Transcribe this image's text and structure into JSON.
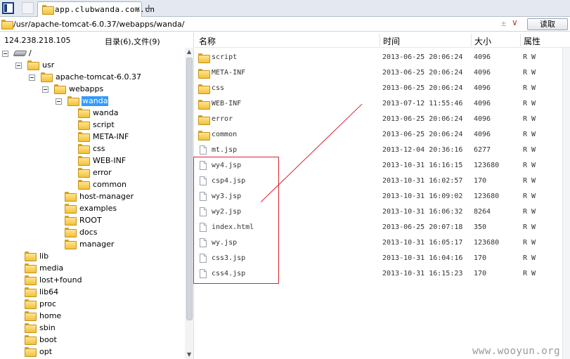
{
  "tab": {
    "title": "app.clubwanda.com.cn",
    "close_icon": "×",
    "add_icon": "+"
  },
  "address": {
    "path": "/usr/apache-tomcat-6.0.37/webapps/wanda/",
    "plus_icon": "±",
    "dropdown_icon": "∨",
    "read_button": "读取"
  },
  "left": {
    "ip": "124.238.218.105",
    "counts": "目录(6),文件(9)",
    "tree": [
      {
        "label": "/",
        "level": 0,
        "icon": "drive",
        "toggle": true
      },
      {
        "label": "usr",
        "level": 1,
        "icon": "folder",
        "toggle": true
      },
      {
        "label": "apache-tomcat-6.0.37",
        "level": 2,
        "icon": "folder",
        "toggle": true
      },
      {
        "label": "webapps",
        "level": 3,
        "icon": "folder",
        "toggle": true
      },
      {
        "label": "wanda",
        "level": 4,
        "icon": "folder",
        "toggle": true,
        "selected": true
      },
      {
        "label": "wanda",
        "level": 5,
        "icon": "folder"
      },
      {
        "label": "script",
        "level": 5,
        "icon": "folder"
      },
      {
        "label": "META-INF",
        "level": 5,
        "icon": "folder"
      },
      {
        "label": "css",
        "level": 5,
        "icon": "folder"
      },
      {
        "label": "WEB-INF",
        "level": 5,
        "icon": "folder"
      },
      {
        "label": "error",
        "level": 5,
        "icon": "folder"
      },
      {
        "label": "common",
        "level": 5,
        "icon": "folder"
      },
      {
        "label": "host-manager",
        "level": 4,
        "icon": "folder"
      },
      {
        "label": "examples",
        "level": 4,
        "icon": "folder"
      },
      {
        "label": "ROOT",
        "level": 4,
        "icon": "folder"
      },
      {
        "label": "docs",
        "level": 4,
        "icon": "folder"
      },
      {
        "label": "manager",
        "level": 4,
        "icon": "folder"
      },
      {
        "label": "lib",
        "level": 1,
        "icon": "folder"
      },
      {
        "label": "media",
        "level": 1,
        "icon": "folder"
      },
      {
        "label": "lost+found",
        "level": 1,
        "icon": "folder"
      },
      {
        "label": "lib64",
        "level": 1,
        "icon": "folder"
      },
      {
        "label": "proc",
        "level": 1,
        "icon": "folder"
      },
      {
        "label": "home",
        "level": 1,
        "icon": "folder"
      },
      {
        "label": "sbin",
        "level": 1,
        "icon": "folder"
      },
      {
        "label": "boot",
        "level": 1,
        "icon": "folder"
      },
      {
        "label": "opt",
        "level": 1,
        "icon": "folder"
      }
    ]
  },
  "columns": {
    "name": "名称",
    "time": "时间",
    "size": "大小",
    "attr": "属性"
  },
  "files": [
    {
      "name": "script",
      "time": "2013-06-25 20:06:24",
      "size": "4096",
      "attr": "R W",
      "icon": "folder"
    },
    {
      "name": "META-INF",
      "time": "2013-06-25 20:06:24",
      "size": "4096",
      "attr": "R W",
      "icon": "folder"
    },
    {
      "name": "css",
      "time": "2013-06-25 20:06:24",
      "size": "4096",
      "attr": "R W",
      "icon": "folder"
    },
    {
      "name": "WEB-INF",
      "time": "2013-07-12 11:55:46",
      "size": "4096",
      "attr": "R W",
      "icon": "folder"
    },
    {
      "name": "error",
      "time": "2013-06-25 20:06:24",
      "size": "4096",
      "attr": "R W",
      "icon": "folder"
    },
    {
      "name": "common",
      "time": "2013-06-25 20:06:24",
      "size": "4096",
      "attr": "R W",
      "icon": "folder"
    },
    {
      "name": "mt.jsp",
      "time": "2013-12-04 20:36:16",
      "size": "6277",
      "attr": "R W",
      "icon": "file"
    },
    {
      "name": "wy4.jsp",
      "time": "2013-10-31 16:16:15",
      "size": "123680",
      "attr": "R W",
      "icon": "file"
    },
    {
      "name": "csp4.jsp",
      "time": "2013-10-31 16:02:57",
      "size": "170",
      "attr": "R W",
      "icon": "file"
    },
    {
      "name": "wy3.jsp",
      "time": "2013-10-31 16:09:02",
      "size": "123680",
      "attr": "R W",
      "icon": "file"
    },
    {
      "name": "wy2.jsp",
      "time": "2013-10-31 16:06:32",
      "size": "8264",
      "attr": "R W",
      "icon": "file"
    },
    {
      "name": "index.html",
      "time": "2013-06-25 20:07:18",
      "size": "350",
      "attr": "R W",
      "icon": "file"
    },
    {
      "name": "wy.jsp",
      "time": "2013-10-31 16:05:17",
      "size": "123680",
      "attr": "R W",
      "icon": "file"
    },
    {
      "name": "css3.jsp",
      "time": "2013-10-31 16:04:16",
      "size": "170",
      "attr": "R W",
      "icon": "file"
    },
    {
      "name": "css4.jsp",
      "time": "2013-10-31 16:15:23",
      "size": "170",
      "attr": "R W",
      "icon": "file"
    }
  ],
  "watermark": "www.wooyun.org",
  "colors": {
    "selection": "#3399ff",
    "annotation": "#d9232c",
    "folder": "#f3c13a"
  }
}
